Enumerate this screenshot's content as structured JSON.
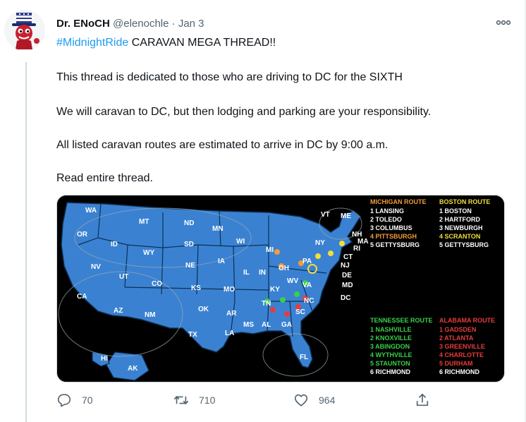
{
  "tweet": {
    "display_name": "Dr. ENoCH",
    "handle": "@elenochle",
    "separator": "·",
    "date": "Jan 3",
    "hashtag": "#MidnightRide",
    "line1_rest": " CARAVAN MEGA THREAD!!",
    "line2": "This thread is dedicated to those who are driving to DC for the SIXTH",
    "line3": "We will caravan to DC, but then lodging and parking are your responsibility.",
    "line4": "All listed caravan routes are estimated to arrive in DC by 9:00 a.m.",
    "line5": "Read entire thread."
  },
  "actions": {
    "reply_count": "70",
    "retweet_count": "710",
    "like_count": "964"
  },
  "icons": {
    "avatar": "uncle-sam-character-icon",
    "more": "more-options-icon",
    "reply": "reply-icon",
    "retweet": "retweet-icon",
    "like": "like-icon",
    "share": "share-icon"
  },
  "map": {
    "state_labels": [
      "WA",
      "OR",
      "CA",
      "ID",
      "NV",
      "MT",
      "WY",
      "UT",
      "AZ",
      "CO",
      "NM",
      "ND",
      "SD",
      "NE",
      "KS",
      "OK",
      "TX",
      "MN",
      "IA",
      "MO",
      "AR",
      "LA",
      "WI",
      "IL",
      "MS",
      "MI",
      "IN",
      "KY",
      "TN",
      "AL",
      "OH",
      "WV",
      "VA",
      "NC",
      "SC",
      "GA",
      "FL",
      "PA",
      "NY",
      "VT",
      "ME",
      "NH",
      "MA",
      "RI",
      "CT",
      "NJ",
      "DE",
      "MD",
      "DC",
      "HI",
      "AK"
    ],
    "routes": {
      "michigan": {
        "title": "MICHIGAN ROUTE",
        "stops": [
          "1 LANSING",
          "2 TOLEDO",
          "3 COLUMBUS",
          "4 PITTSBURGH",
          "5 GETTYSBURG"
        ]
      },
      "boston": {
        "title": "BOSTON ROUTE",
        "stops": [
          "1 BOSTON",
          "2 HARTFORD",
          "3 NEWBURGH",
          "4 SCRANTON",
          "5 GETTYSBURG"
        ]
      },
      "tennessee": {
        "title": "TENNESSEE ROUTE",
        "stops": [
          "1 NASHVILLE",
          "2 KNOXVILLE",
          "3 ABINGDON",
          "4 WYTHVILLE",
          "5 STAUNTON",
          "6 RICHMOND"
        ]
      },
      "alabama": {
        "title": "ALABAMA ROUTE",
        "stops": [
          "1 GADSDEN",
          "2 ATLANTA",
          "3 GREENVILLE",
          "4 CHARLOTTE",
          "5 DURHAM",
          "6 RICHMOND"
        ]
      }
    },
    "colors": {
      "michigan": "#f39c3a",
      "boston": "#f2df3a",
      "tennessee": "#39d14a",
      "alabama": "#e83b3b",
      "state_fill": "#3a82d1",
      "state_stroke": "#0d2f55",
      "background": "#000000"
    }
  },
  "colors": {
    "link": "#1d9bf0",
    "secondary_text": "#536471",
    "primary_text": "#0f1419"
  }
}
